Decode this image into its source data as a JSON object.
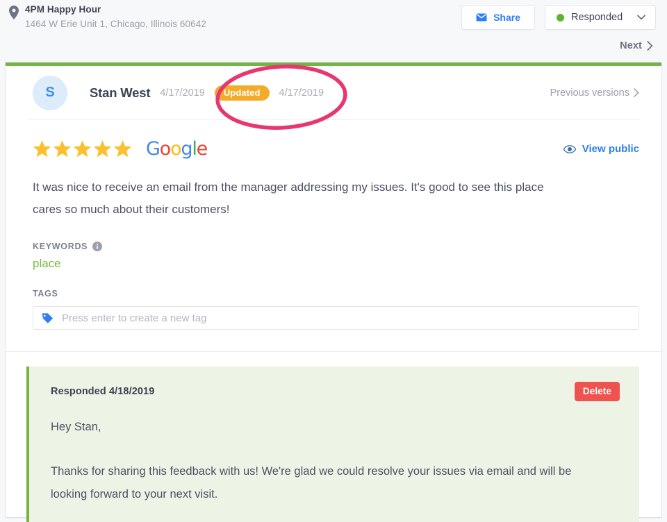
{
  "header": {
    "location_icon": "map-pin-icon",
    "location_name": "4PM Happy Hour",
    "location_address": "1464 W Erie Unit 1, Chicago, Illinois 60642",
    "share_button": {
      "label": "Share",
      "icon": "envelope-icon",
      "color": "#2f7ff0"
    },
    "status_button": {
      "label": "Responded",
      "dot_color": "#5cb531",
      "icon": "chevron-down-icon"
    },
    "next_link": {
      "label": "Next",
      "icon": "chevron-right-icon"
    }
  },
  "review": {
    "accent_bar_color": "#72b544",
    "avatar_initial": "S",
    "avatar_bg": "#ddecfb",
    "avatar_color": "#3b8ef0",
    "reviewer_name": "Stan West",
    "date": "4/17/2019",
    "updated_badge": "Updated",
    "updated_badge_color": "#f4ab27",
    "updated_date": "4/17/2019",
    "previous_versions_label": "Previous versions",
    "previous_versions_icon": "chevron-right-icon",
    "rating": 5,
    "max_rating": 5,
    "star_color": "#fbc02d",
    "source": "Google",
    "source_logo_letters": [
      {
        "char": "G",
        "color": "#4285f4"
      },
      {
        "char": "o",
        "color": "#ea4335"
      },
      {
        "char": "o",
        "color": "#fbbc05"
      },
      {
        "char": "g",
        "color": "#4285f4"
      },
      {
        "char": "l",
        "color": "#34a853"
      },
      {
        "char": "e",
        "color": "#ea4335"
      }
    ],
    "view_public": {
      "label": "View public",
      "icon": "eye-icon",
      "color": "#2f7ff0"
    },
    "body": "It was nice to receive an email from the manager addressing my issues. It's good to see this place cares so much about their customers!",
    "keywords_label": "KEYWORDS",
    "keywords_info_icon": "info-icon",
    "keywords": "place",
    "keywords_color": "#77ba46",
    "tags_label": "TAGS",
    "tag_input_placeholder": "Press enter to create a new tag",
    "tag_input_value": "",
    "tag_icon": "tag-icon"
  },
  "response": {
    "header_label": "Responded 4/18/2019",
    "delete_button": "Delete",
    "delete_button_color": "#ef5350",
    "background": "#edf4e5",
    "border_color": "#79b33f",
    "paragraphs": [
      "Hey Stan,",
      "Thanks for sharing this feedback with us! We're glad we could resolve your issues via email and will be looking forward to your next visit."
    ]
  },
  "annotation": {
    "shape": "ellipse",
    "color": "#e8366e",
    "target": "updated-badge"
  }
}
